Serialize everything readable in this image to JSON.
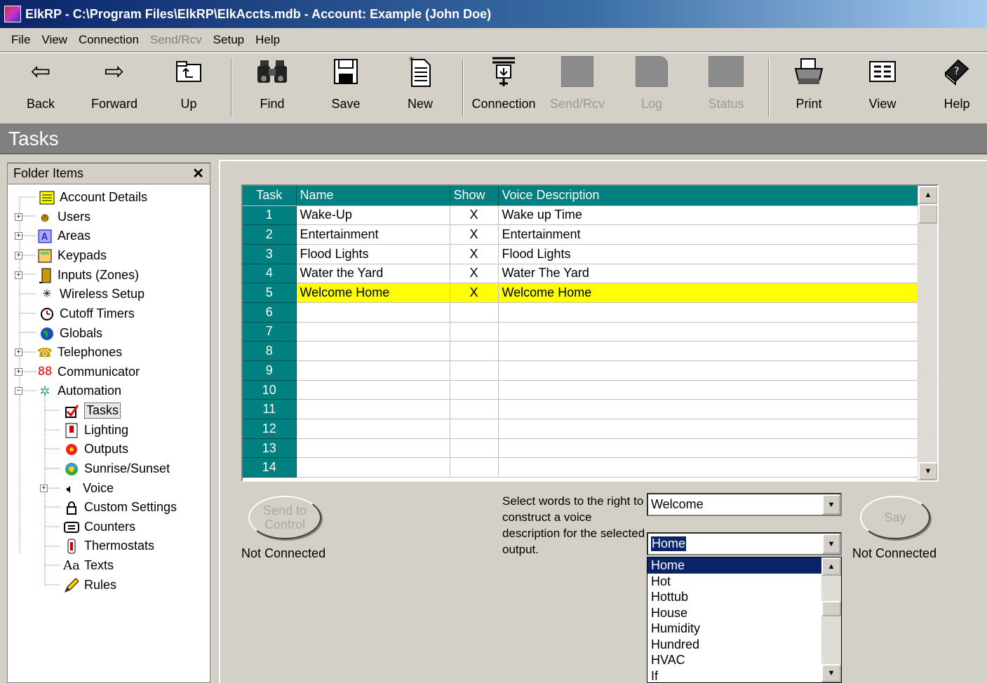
{
  "window": {
    "title": "ElkRP - C:\\Program Files\\ElkRP\\ElkAccts.mdb - Account: Example (John Doe)"
  },
  "menu": {
    "file": "File",
    "view": "View",
    "connection": "Connection",
    "sendrcv": "Send/Rcv",
    "setup": "Setup",
    "help": "Help"
  },
  "toolbar": {
    "back": "Back",
    "forward": "Forward",
    "up": "Up",
    "find": "Find",
    "save": "Save",
    "new": "New",
    "connection": "Connection",
    "sendrcv": "Send/Rcv",
    "log": "Log",
    "status": "Status",
    "print": "Print",
    "view": "View",
    "help": "Help"
  },
  "page": {
    "title": "Tasks"
  },
  "folder": {
    "header": "Folder Items",
    "close": "✕",
    "items": [
      {
        "label": "Account Details"
      },
      {
        "label": "Users"
      },
      {
        "label": "Areas"
      },
      {
        "label": "Keypads"
      },
      {
        "label": "Inputs (Zones)"
      },
      {
        "label": "Wireless Setup"
      },
      {
        "label": "Cutoff Timers"
      },
      {
        "label": "Globals"
      },
      {
        "label": "Telephones"
      },
      {
        "label": "Communicator"
      },
      {
        "label": "Automation"
      },
      {
        "label": "Tasks"
      },
      {
        "label": "Lighting"
      },
      {
        "label": "Outputs"
      },
      {
        "label": "Sunrise/Sunset"
      },
      {
        "label": "Voice"
      },
      {
        "label": "Custom Settings"
      },
      {
        "label": "Counters"
      },
      {
        "label": "Thermostats"
      },
      {
        "label": "Texts"
      },
      {
        "label": "Rules"
      }
    ]
  },
  "grid": {
    "headers": {
      "task": "Task",
      "name": "Name",
      "show": "Show",
      "voice": "Voice Description"
    },
    "rows": [
      {
        "task": "1",
        "name": "Wake-Up",
        "show": "X",
        "voice": "Wake up Time"
      },
      {
        "task": "2",
        "name": "Entertainment",
        "show": "X",
        "voice": "Entertainment"
      },
      {
        "task": "3",
        "name": "Flood Lights",
        "show": "X",
        "voice": "Flood Lights"
      },
      {
        "task": "4",
        "name": "Water the Yard",
        "show": "X",
        "voice": "Water The Yard"
      },
      {
        "task": "5",
        "name": "Welcome Home",
        "show": "X",
        "voice": "Welcome Home"
      },
      {
        "task": "6",
        "name": "",
        "show": "",
        "voice": ""
      },
      {
        "task": "7",
        "name": "",
        "show": "",
        "voice": ""
      },
      {
        "task": "8",
        "name": "",
        "show": "",
        "voice": ""
      },
      {
        "task": "9",
        "name": "",
        "show": "",
        "voice": ""
      },
      {
        "task": "10",
        "name": "",
        "show": "",
        "voice": ""
      },
      {
        "task": "11",
        "name": "",
        "show": "",
        "voice": ""
      },
      {
        "task": "12",
        "name": "",
        "show": "",
        "voice": ""
      },
      {
        "task": "13",
        "name": "",
        "show": "",
        "voice": ""
      },
      {
        "task": "14",
        "name": "",
        "show": "",
        "voice": ""
      }
    ],
    "highlight_color": "#ffff00",
    "header_color": "#008080"
  },
  "controls": {
    "send_line1": "Send to",
    "send_line2": "Control",
    "send_status": "Not Connected",
    "hint": "Select words to the right to construct a voice description for the selected output.",
    "combo1_value": "Welcome",
    "combo2_value": "Home",
    "say": "Say",
    "say_status": "Not Connected",
    "list": [
      "Home",
      "Hot",
      "Hottub",
      "House",
      "Humidity",
      "Hundred",
      "HVAC",
      "If"
    ]
  }
}
